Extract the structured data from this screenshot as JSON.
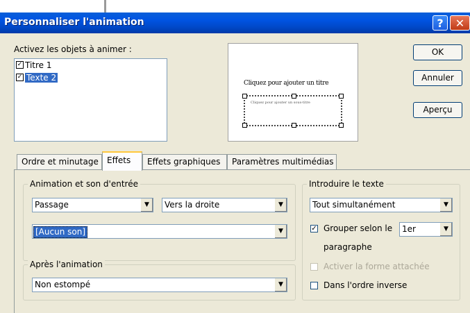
{
  "window": {
    "title": "Personnaliser l'animation",
    "help_glyph": "?",
    "close_glyph": "✕"
  },
  "objects": {
    "label": "Activez les objets à animer :",
    "items": [
      {
        "label": "Titre 1",
        "checked": true,
        "selected": false
      },
      {
        "label": "Texte 2",
        "checked": true,
        "selected": true
      }
    ]
  },
  "preview": {
    "title_placeholder": "Cliquez pour ajouter un titre",
    "subtitle_placeholder": "Cliquez pour ajouter un sous-titre"
  },
  "buttons": {
    "ok": "OK",
    "cancel": "Annuler",
    "preview": "Aperçu"
  },
  "tabs": [
    {
      "label": "Ordre et minutage",
      "active": false
    },
    {
      "label": "Effets",
      "active": true
    },
    {
      "label": "Effets graphiques",
      "active": false
    },
    {
      "label": "Paramètres multimédias",
      "active": false
    }
  ],
  "entry": {
    "group_label": "Animation et son d'entrée",
    "effect": "Passage",
    "direction": "Vers la droite",
    "sound": "[Aucun son]"
  },
  "after": {
    "group_label": "Après l'animation",
    "value": "Non estompé"
  },
  "text_intro": {
    "group_label": "Introduire le texte",
    "mode": "Tout simultanément",
    "group_by_label": "Grouper selon le",
    "group_by_level": "1er",
    "group_by_suffix": "paragraphe",
    "group_by_checked": true,
    "attach_shape_label": "Activer la forme attachée",
    "attach_shape_checked": false,
    "reverse_label": "Dans l'ordre inverse",
    "reverse_checked": false
  },
  "check_glyph": "✓",
  "dropdown_glyph": "▼"
}
